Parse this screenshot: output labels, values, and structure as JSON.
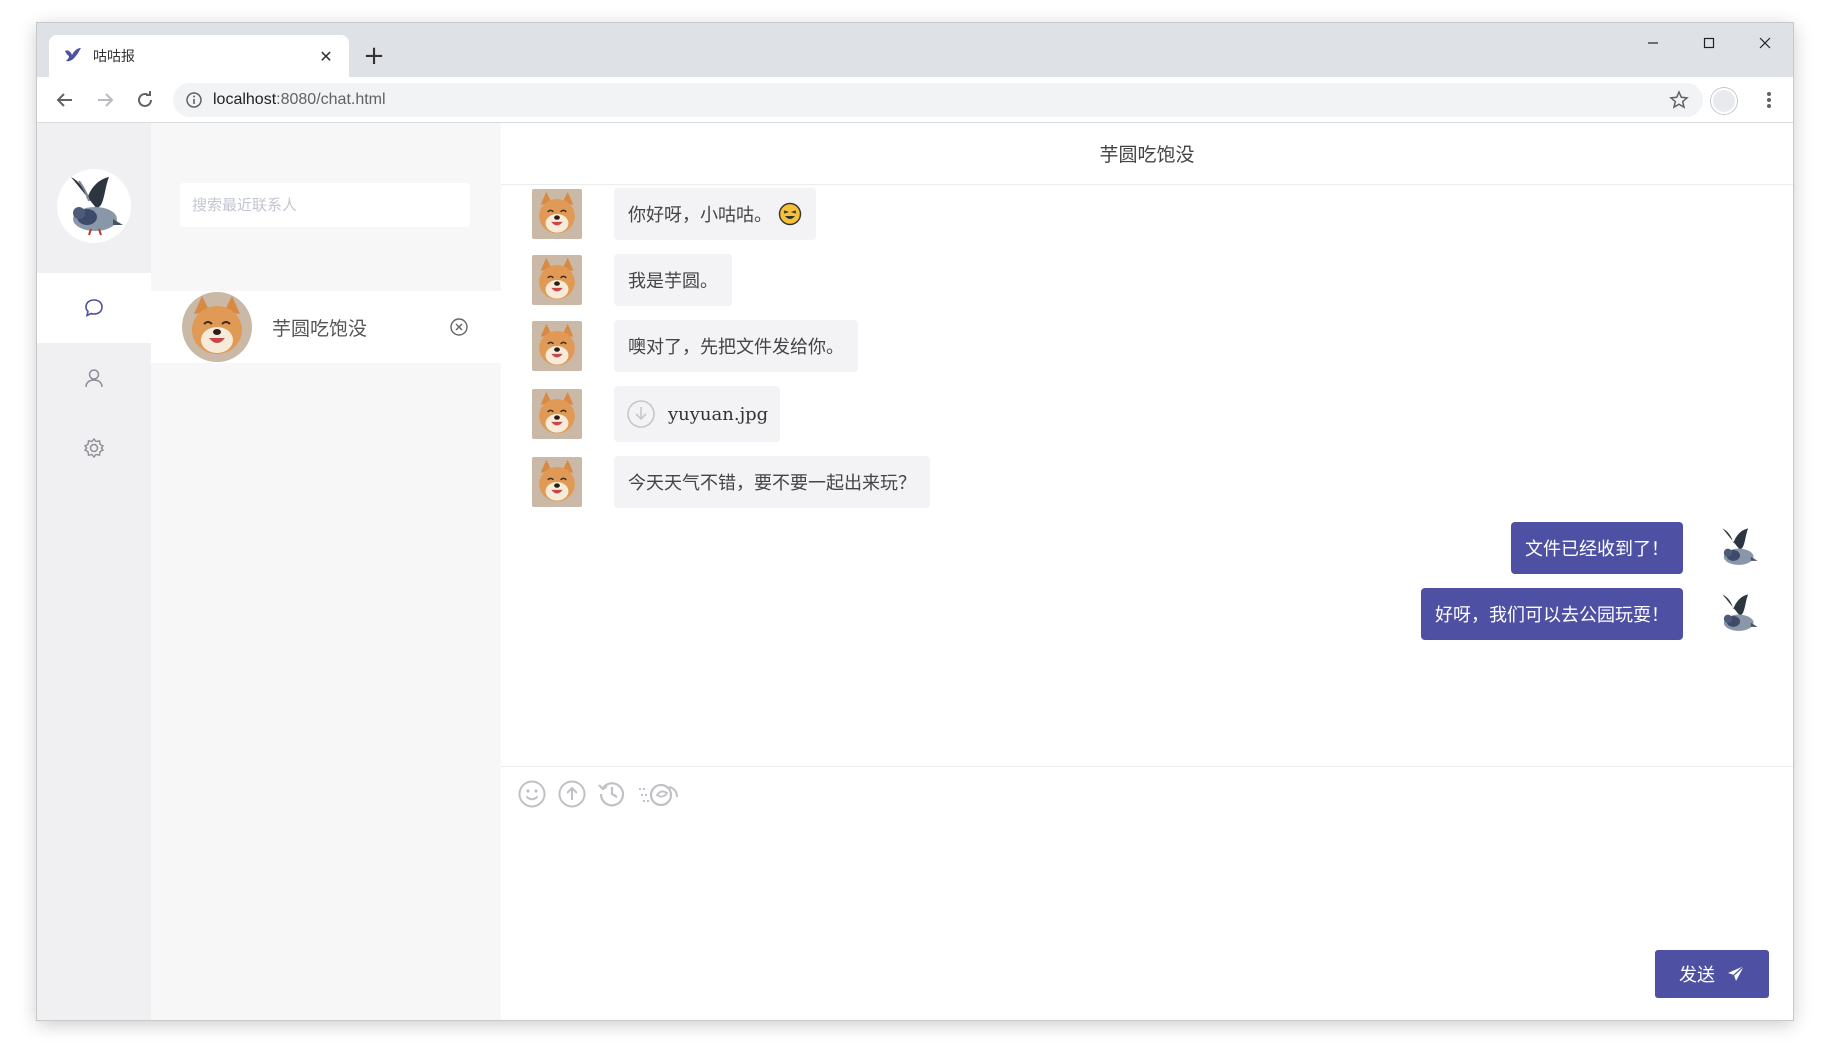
{
  "browser": {
    "tab_title": "咕咕报",
    "tab_close": "✕",
    "new_tab": "+",
    "url_host": "localhost",
    "url_path": ":8080/chat.html"
  },
  "sidebar": {
    "search_placeholder": "搜索最近联系人",
    "contacts": [
      {
        "name": "芋圆吃饱没"
      }
    ]
  },
  "chat": {
    "title": "芋圆吃饱没",
    "messages": [
      {
        "side": "left",
        "text": "你好呀，小咕咕。"
      },
      {
        "side": "left",
        "text": "我是芋圆。"
      },
      {
        "side": "left",
        "text": "噢对了，先把文件发给你。"
      },
      {
        "side": "left",
        "type": "file",
        "text": "yuyuan.jpg"
      },
      {
        "side": "left",
        "text": "今天天气不错，要不要一起出来玩？"
      },
      {
        "side": "right",
        "text": "文件已经收到了！"
      },
      {
        "side": "right",
        "text": "好呀，我们可以去公园玩耍！"
      }
    ],
    "send_label": "发送"
  },
  "colors": {
    "accent": "#4e51a3",
    "rail_bg": "#f0f0f2",
    "panel_bg": "#f7f7f8",
    "bubble_left_bg": "#f3f3f5"
  },
  "icons": {
    "tab_favicon": "pigeon-icon",
    "rail": [
      "chat-bubble-icon",
      "user-icon",
      "settings-gear-icon"
    ],
    "composer_tools": [
      "emoji-icon",
      "upload-icon",
      "history-icon",
      "screenshot-icon"
    ],
    "send": "paper-plane-icon"
  }
}
